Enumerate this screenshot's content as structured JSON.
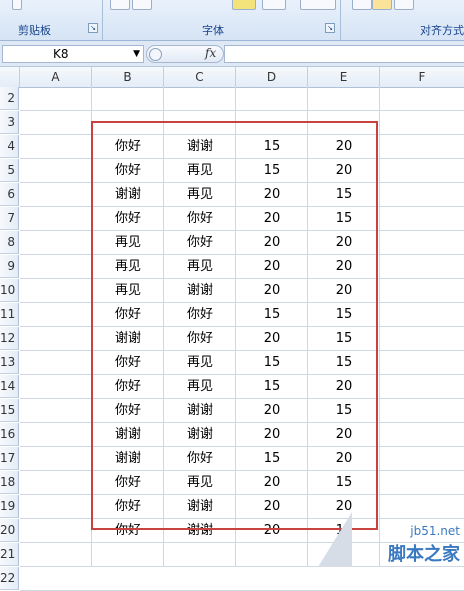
{
  "ribbon": {
    "clipboard_label": "剪贴板",
    "font_label": "字体",
    "align_label": "对齐方式"
  },
  "formula_bar": {
    "name_box": "K8",
    "fx": "fx",
    "value": ""
  },
  "columns": [
    "A",
    "B",
    "C",
    "D",
    "E",
    "F"
  ],
  "rows": [
    "2",
    "3",
    "4",
    "5",
    "6",
    "7",
    "8",
    "9",
    "10",
    "11",
    "12",
    "13",
    "14",
    "15",
    "16",
    "17",
    "18",
    "19",
    "20",
    "21",
    "22"
  ],
  "table": [
    [
      "你好",
      "谢谢",
      "15",
      "20"
    ],
    [
      "你好",
      "再见",
      "15",
      "20"
    ],
    [
      "谢谢",
      "再见",
      "20",
      "15"
    ],
    [
      "你好",
      "你好",
      "20",
      "15"
    ],
    [
      "再见",
      "你好",
      "20",
      "20"
    ],
    [
      "再见",
      "再见",
      "20",
      "20"
    ],
    [
      "再见",
      "谢谢",
      "20",
      "20"
    ],
    [
      "你好",
      "你好",
      "15",
      "15"
    ],
    [
      "谢谢",
      "你好",
      "20",
      "15"
    ],
    [
      "你好",
      "再见",
      "15",
      "15"
    ],
    [
      "你好",
      "再见",
      "15",
      "20"
    ],
    [
      "你好",
      "谢谢",
      "20",
      "15"
    ],
    [
      "谢谢",
      "谢谢",
      "20",
      "20"
    ],
    [
      "谢谢",
      "你好",
      "15",
      "20"
    ],
    [
      "你好",
      "再见",
      "20",
      "15"
    ],
    [
      "你好",
      "谢谢",
      "20",
      "20"
    ],
    [
      "你好",
      "谢谢",
      "20",
      "15"
    ]
  ],
  "watermark": {
    "site": "jb51.net",
    "name": "脚本之家"
  },
  "colors": {
    "highlight_border": "#c8423f",
    "ribbon_text": "#15428b"
  }
}
